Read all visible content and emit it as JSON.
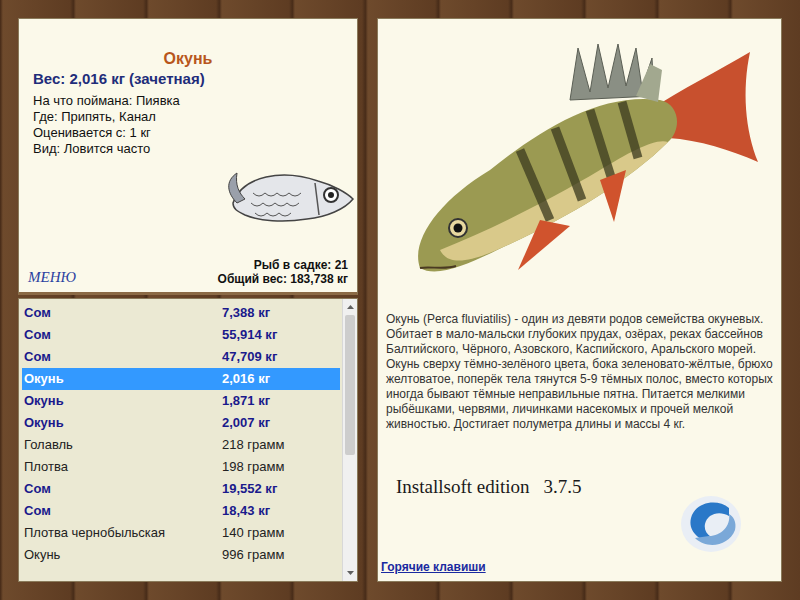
{
  "fish_card": {
    "title": "Окунь",
    "weight": "Вес: 2,016 кг (зачетная)",
    "bait": "На что поймана: Пиявка",
    "place": "Где: Припять, Канал",
    "rated_from": "Оценивается с: 1 кг",
    "frequency": "Вид: Ловится часто",
    "menu": "МЕНЮ",
    "count": "Рыб в садке: 21",
    "total": "Общий вес: 183,738 кг"
  },
  "catch_list": {
    "scroll_level": 1,
    "rows": [
      {
        "name": "Сом",
        "weight": "7,388 кг",
        "trophy": true,
        "selected": false
      },
      {
        "name": "Сом",
        "weight": "55,914 кг",
        "trophy": true,
        "selected": false
      },
      {
        "name": "Сом",
        "weight": "47,709 кг",
        "trophy": true,
        "selected": false
      },
      {
        "name": "Окунь",
        "weight": "2,016 кг",
        "trophy": true,
        "selected": true
      },
      {
        "name": "Окунь",
        "weight": "1,871 кг",
        "trophy": true,
        "selected": false
      },
      {
        "name": "Окунь",
        "weight": "2,007 кг",
        "trophy": true,
        "selected": false
      },
      {
        "name": "Голавль",
        "weight": "218 грамм",
        "trophy": false,
        "selected": false
      },
      {
        "name": "Плотва",
        "weight": "198 грамм",
        "trophy": false,
        "selected": false
      },
      {
        "name": "Сом",
        "weight": "19,552 кг",
        "trophy": true,
        "selected": false
      },
      {
        "name": "Сом",
        "weight": "18,43 кг",
        "trophy": true,
        "selected": false
      },
      {
        "name": "Плотва чернобыльская",
        "weight": "140 грамм",
        "trophy": false,
        "selected": false
      },
      {
        "name": "Окунь",
        "weight": "996 грамм",
        "trophy": false,
        "selected": false
      }
    ]
  },
  "description": "Окунь (Perca fluviatilis) - один из девяти родов семейства окуневых. Обитает в мало-мальски глубоких прудах, озёрах, реках бассейнов Балтийского, Чёрного, Азовского, Каспийского, Аральского морей. Окунь сверху тёмно-зелёного цвета, бока зеленовато-жёлтые, брюхо желтоватое, поперёк тела тянутся 5-9 тёмных полос, вместо которых иногда бывают тёмные неправильные пятна. Питается мелкими рыбёшками, червями, личинками насекомых и прочей мелкой живностью. Достигает полуметра длины и массы 4 кг.",
  "edition": "Installsoft edition",
  "version": "3.7.5",
  "hotkeys": "Горячие клавиши"
}
